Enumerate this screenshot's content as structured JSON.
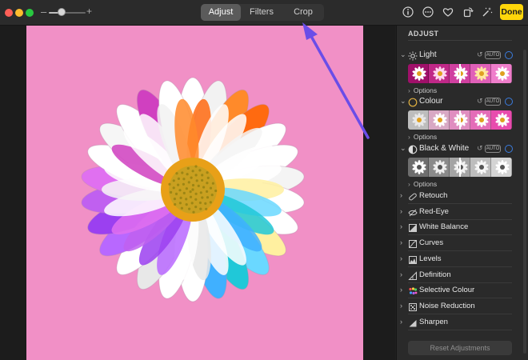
{
  "toolbar": {
    "zoom_minus": "–",
    "zoom_plus": "+",
    "zoom_level": 0.35,
    "tabs": [
      {
        "label": "Adjust",
        "active": true
      },
      {
        "label": "Filters",
        "active": false
      },
      {
        "label": "Crop",
        "active": false
      }
    ],
    "icons": [
      "info-icon",
      "more-icon",
      "heart-icon",
      "rotate-icon",
      "magic-wand-icon"
    ],
    "done_label": "Done",
    "accent": "#ffd60a"
  },
  "photo": {
    "background": "#f190c6",
    "subject": "flower-image"
  },
  "sidebar": {
    "title": "ADJUST",
    "sections": [
      {
        "label": "Light",
        "icon": "sun-icon",
        "undo": "↺",
        "auto": "AUTO",
        "marker": 0.5
      },
      {
        "label": "Colour",
        "icon": "colour-circle-icon",
        "undo": "↺",
        "auto": "AUTO",
        "marker": 0.5
      },
      {
        "label": "Black & White",
        "icon": "half-circle-icon",
        "undo": "↺",
        "auto": "AUTO",
        "marker": 0.5
      }
    ],
    "options_label": "Options",
    "items": [
      {
        "label": "Retouch",
        "icon": "bandage-icon"
      },
      {
        "label": "Red-Eye",
        "icon": "eye-icon"
      },
      {
        "label": "White Balance",
        "icon": "white-balance-icon"
      },
      {
        "label": "Curves",
        "icon": "curves-icon"
      },
      {
        "label": "Levels",
        "icon": "levels-icon"
      },
      {
        "label": "Definition",
        "icon": "definition-icon"
      },
      {
        "label": "Selective Colour",
        "icon": "selective-colour-icon"
      },
      {
        "label": "Noise Reduction",
        "icon": "noise-icon"
      },
      {
        "label": "Sharpen",
        "icon": "sharpen-icon"
      }
    ],
    "reset_label": "Reset Adjustments",
    "toggle_color": "#3b7de0"
  }
}
